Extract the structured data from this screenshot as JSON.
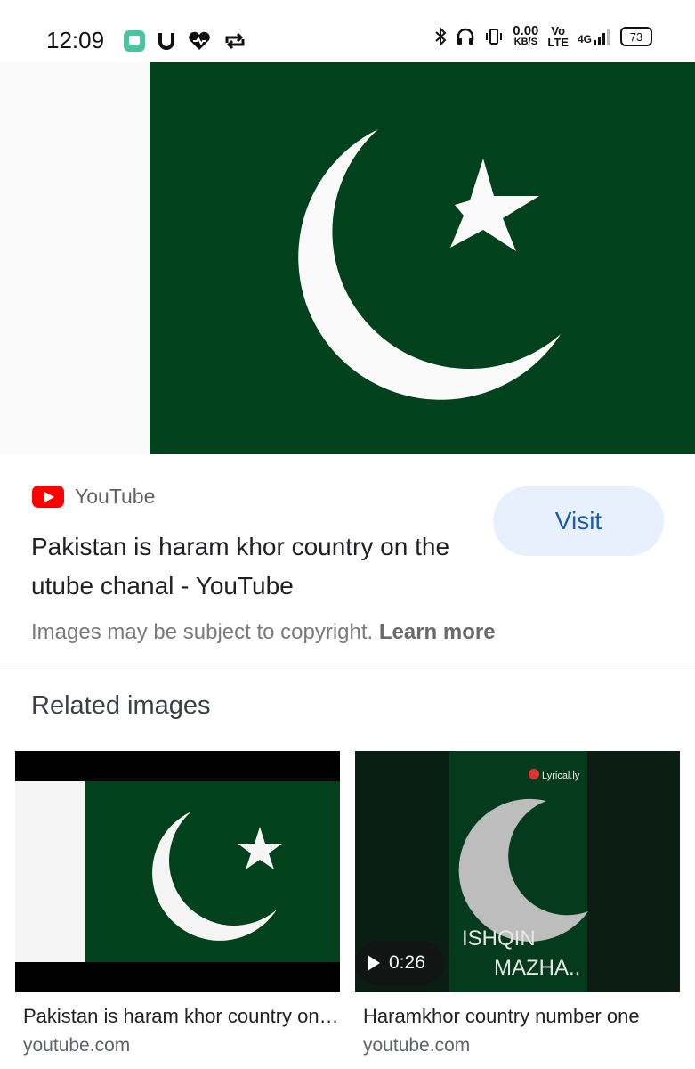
{
  "status_bar": {
    "time": "12:09",
    "speed": "0.00",
    "speed_unit": "KB/S",
    "volte_top": "Vo",
    "volte_bottom": "LTE",
    "network": "4G",
    "battery": "73"
  },
  "result": {
    "source": "YouTube",
    "title": "Pakistan is haram khor country on the utube chanal - YouTube",
    "visit_label": "Visit",
    "copyright_text": "Images may be subject to copyright.",
    "learn_more": "Learn more"
  },
  "related": {
    "heading": "Related images",
    "items": [
      {
        "caption": "Pakistan is haram khor country on the utube chanal",
        "domain": "youtube.com"
      },
      {
        "caption": "Haramkhor country number one",
        "domain": "youtube.com",
        "duration": "0:26",
        "overlay_line1": "ISHQIN",
        "overlay_line2": "MAZHA..",
        "watermark": "Lyrical.ly"
      }
    ]
  },
  "colors": {
    "flag_green": "#01411c",
    "accent_blue": "#1a5bb5",
    "visit_bg": "#e8f0fe"
  }
}
